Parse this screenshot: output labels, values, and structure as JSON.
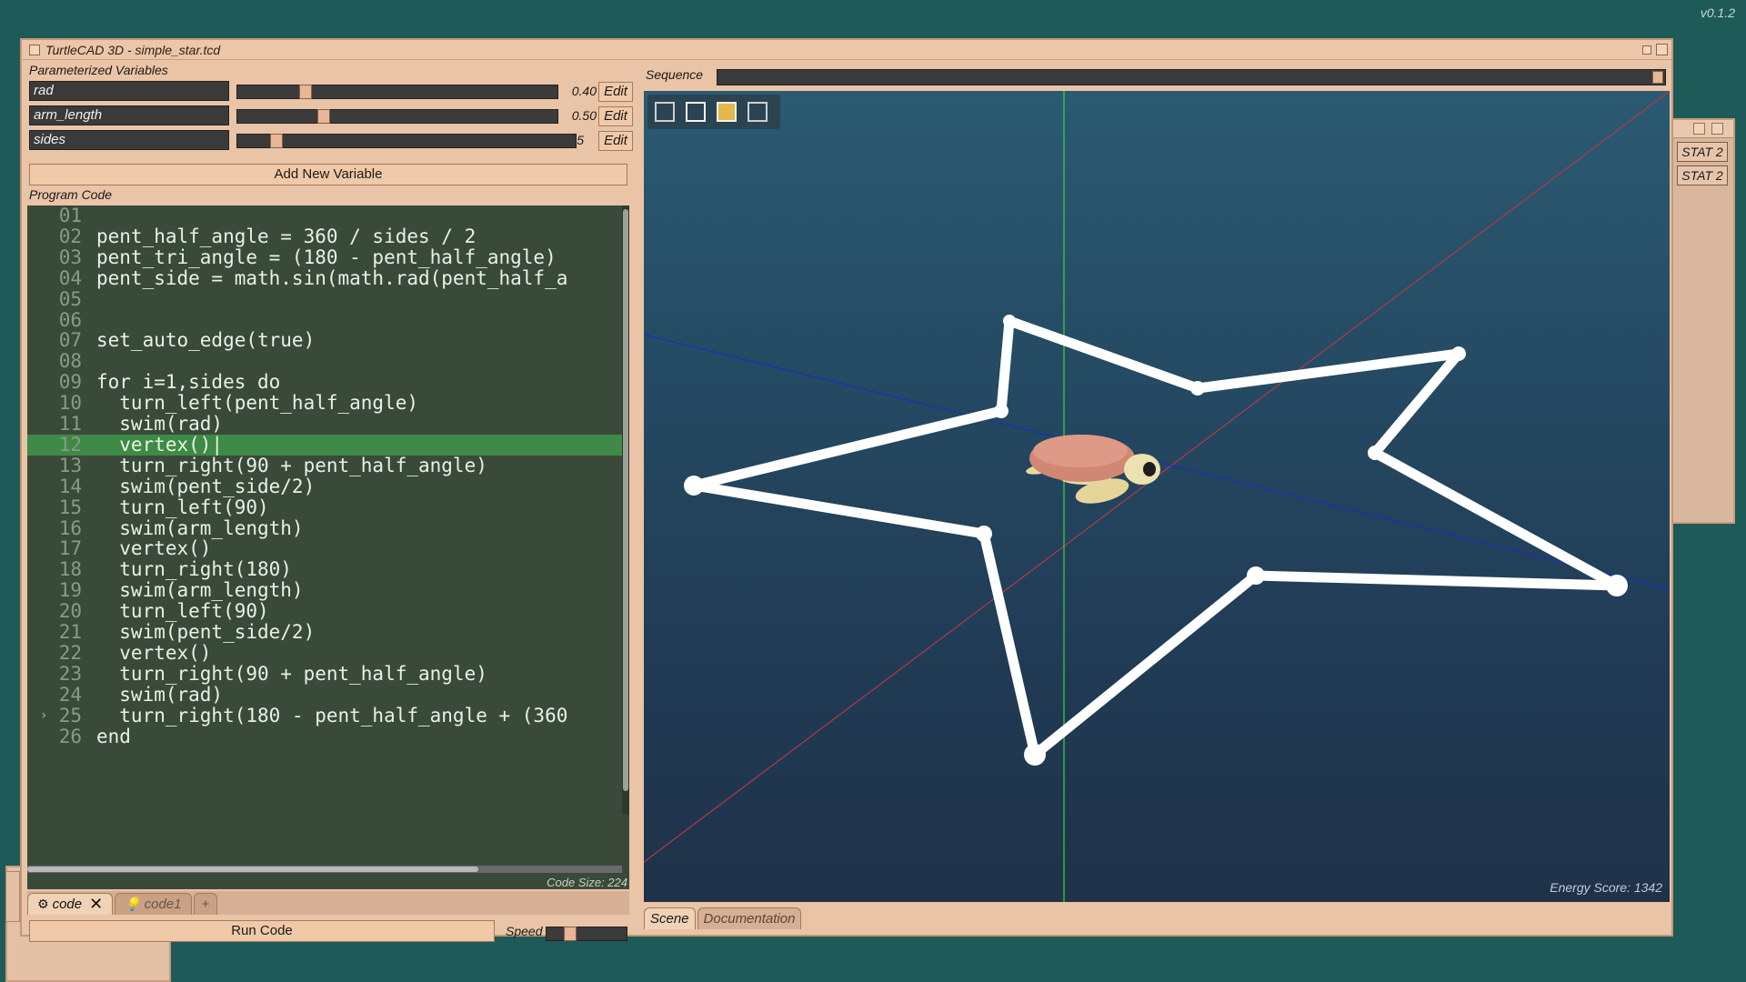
{
  "version": "v0.1.2",
  "window": {
    "title": "TurtleCAD 3D - simple_star.tcd"
  },
  "variables": {
    "section_label": "Parameterized Variables",
    "items": [
      {
        "name": "rad",
        "value": "0.40",
        "fraction": 0.2,
        "edit_label": "Edit"
      },
      {
        "name": "arm_length",
        "value": "0.50",
        "fraction": 0.26,
        "edit_label": "Edit"
      },
      {
        "name": "sides",
        "value": "5",
        "fraction": 0.1,
        "edit_label": "Edit"
      }
    ],
    "add_label": "Add New Variable"
  },
  "program": {
    "section_label": "Program Code",
    "lines": [
      {
        "num": "01",
        "text": ""
      },
      {
        "num": "02",
        "text": "pent_half_angle = 360 / sides / 2"
      },
      {
        "num": "03",
        "text": "pent_tri_angle = (180 - pent_half_angle)"
      },
      {
        "num": "04",
        "text": "pent_side = math.sin(math.rad(pent_half_a"
      },
      {
        "num": "05",
        "text": ""
      },
      {
        "num": "06",
        "text": ""
      },
      {
        "num": "07",
        "text": "set_auto_edge(true)"
      },
      {
        "num": "08",
        "text": ""
      },
      {
        "num": "09",
        "text": "for i=1,sides do"
      },
      {
        "num": "10",
        "text": "  turn_left(pent_half_angle)"
      },
      {
        "num": "11",
        "text": "  swim(rad)"
      },
      {
        "num": "12",
        "text": "  vertex()|"
      },
      {
        "num": "13",
        "text": "  turn_right(90 + pent_half_angle)"
      },
      {
        "num": "14",
        "text": "  swim(pent_side/2)"
      },
      {
        "num": "15",
        "text": "  turn_left(90)"
      },
      {
        "num": "16",
        "text": "  swim(arm_length)"
      },
      {
        "num": "17",
        "text": "  vertex()"
      },
      {
        "num": "18",
        "text": "  turn_right(180)"
      },
      {
        "num": "19",
        "text": "  swim(arm_length)"
      },
      {
        "num": "20",
        "text": "  turn_left(90)"
      },
      {
        "num": "21",
        "text": "  swim(pent_side/2)"
      },
      {
        "num": "22",
        "text": "  vertex()"
      },
      {
        "num": "23",
        "text": "  turn_right(90 + pent_half_angle)"
      },
      {
        "num": "24",
        "text": "  swim(rad)"
      },
      {
        "num": "25",
        "text": "  turn_right(180 - pent_half_angle + (360"
      },
      {
        "num": "26",
        "text": "end"
      }
    ],
    "highlighted_line": "12",
    "marker_line": "25",
    "code_size": "Code Size: 224"
  },
  "tabs": [
    {
      "label": "code",
      "active": true,
      "icon": "gear-icon"
    },
    {
      "label": "code1",
      "active": false,
      "icon": "bulb-icon"
    }
  ],
  "tab_plus": "+",
  "tab_close": "✕",
  "run": {
    "label": "Run Code",
    "speed_label": "Speed",
    "speed_fraction": 0.25
  },
  "sequence": {
    "label": "Sequence"
  },
  "viewport": {
    "energy": "Energy Score: 1342"
  },
  "view_tabs": [
    {
      "label": "Scene",
      "active": true
    },
    {
      "label": "Documentation",
      "active": false
    }
  ],
  "side_panel": {
    "stats": [
      "STAT 2",
      "STAT 2"
    ]
  },
  "colors": {
    "accent": "#e9c4a6",
    "code_bg": "#3a4a3a",
    "highlight": "#3f8a46",
    "bg": "#1e5a58"
  }
}
